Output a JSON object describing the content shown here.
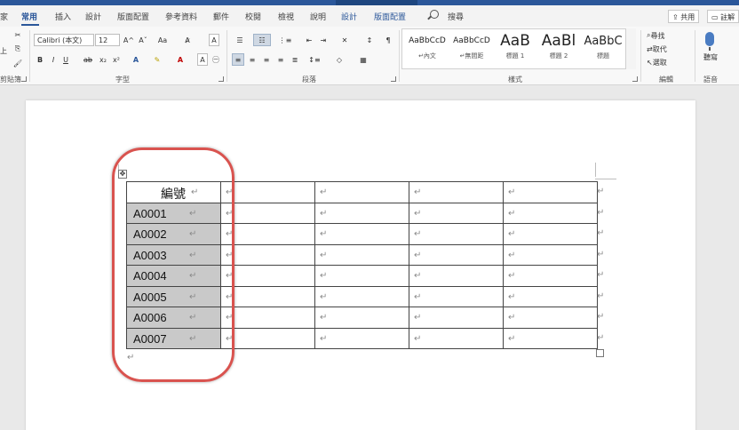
{
  "tabs": {
    "file": "家",
    "home": "常用",
    "insert": "插入",
    "design": "設計",
    "layout": "版面配置",
    "references": "參考資料",
    "mailings": "郵件",
    "review": "校閱",
    "view": "檢視",
    "help": "說明",
    "table_design": "設計",
    "table_layout": "版面配置",
    "search": "搜尋",
    "share": "共用",
    "comments": "註解"
  },
  "ribbon": {
    "clipboard_label": "剪貼簿",
    "font_name": "Calibri (本文)",
    "font_size": "12",
    "font_label": "字型",
    "paragraph_label": "段落",
    "styles_label": "樣式",
    "editing_label": "編輯",
    "voice_label": "語音",
    "find": "尋找",
    "replace": "取代",
    "select": "選取",
    "dictate": "聽寫",
    "bold": "B",
    "italic": "I",
    "underline": "U",
    "strike": "ab",
    "subscript": "x₂",
    "superscript": "x²",
    "grow_font": "A^",
    "shrink_font": "Aˇ",
    "change_case": "Aa",
    "styles": [
      {
        "sample": "AaBbCcD",
        "name": "↵內文"
      },
      {
        "sample": "AaBbCcD",
        "name": "↵無間距"
      },
      {
        "sample": "AaB",
        "name": "標題 1"
      },
      {
        "sample": "AaBl",
        "name": "標題 2"
      },
      {
        "sample": "AaBbC",
        "name": "標題"
      }
    ]
  },
  "table": {
    "header": "編號",
    "rows": [
      "A0001",
      "A0002",
      "A0003",
      "A0004",
      "A0005",
      "A0006",
      "A0007"
    ]
  },
  "marks": {
    "paragraph": "↵"
  },
  "colors": {
    "accent": "#2b579a",
    "shade": "#c9c9c9",
    "highlight": "#d9534f"
  }
}
